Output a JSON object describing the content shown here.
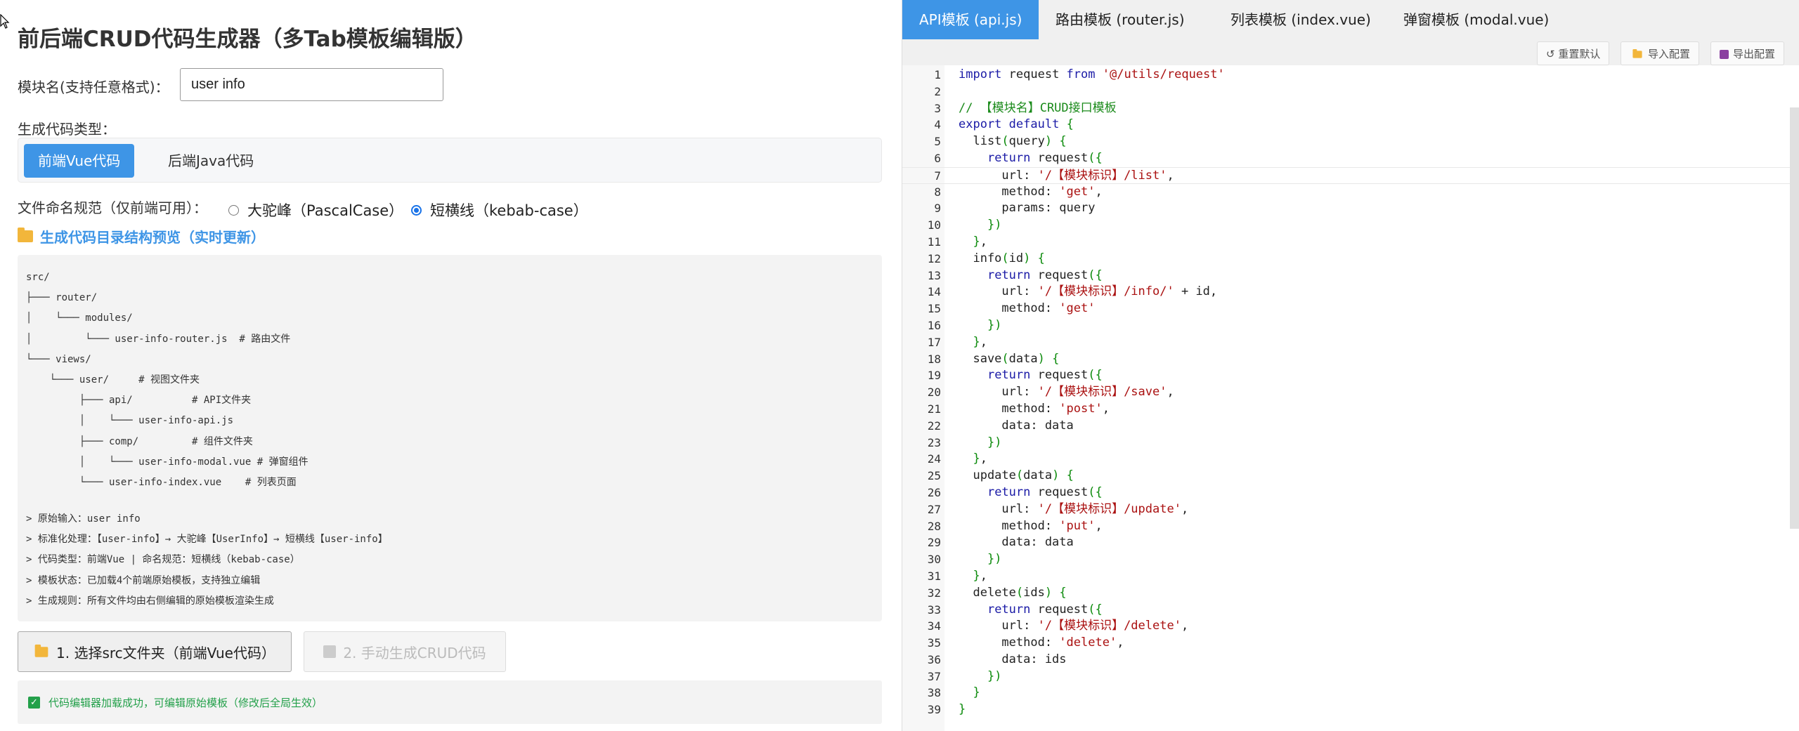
{
  "left": {
    "title": "前后端CRUD代码生成器（多Tab模板编辑版）",
    "module_label": "模块名(支持任意格式)：",
    "module_value": "user info",
    "type_label": "生成代码类型：",
    "type_buttons": [
      "前端Vue代码",
      "后端Java代码"
    ],
    "naming_label": "文件命名规范（仅前端可用）：",
    "naming_options": [
      "大驼峰（PascalCase）",
      "短横线（kebab-case）"
    ],
    "naming_selected": "短横线（kebab-case）",
    "preview_title": "生成代码目录结构预览（实时更新）",
    "tree": [
      "src/",
      "├─── router/",
      "│    └─── modules/",
      "│         └─── user-info-router.js  # 路由文件",
      "└─── views/",
      "    └─── user/     # 视图文件夹",
      "         ├─── api/          # API文件夹",
      "         │    └─── user-info-api.js",
      "         ├─── comp/         # 组件文件夹",
      "         │    └─── user-info-modal.vue # 弹窗组件",
      "         └─── user-info-index.vue    # 列表页面"
    ],
    "info": [
      "> 原始输入：user info",
      "> 标准化处理：【user-info】→ 大驼峰【UserInfo】→ 短横线【user-info】",
      "> 代码类型：前端Vue | 命名规范：短横线（kebab-case）",
      "> 模板状态：已加载4个前端原始模板，支持独立编辑",
      "> 生成规则：所有文件均由右侧编辑的原始模板渲染生成"
    ],
    "btn_select": "1. 选择src文件夹（前端Vue代码）",
    "btn_generate": "2. 手动生成CRUD代码",
    "status": "代码编辑器加载成功，可编辑原始模板（修改后全局生效）"
  },
  "right": {
    "tabs": [
      "API模板 (api.js)",
      "路由模板 (router.js)",
      "列表模板 (index.vue)",
      "弹窗模板 (modal.vue)"
    ],
    "tools": [
      "↺ 重置默认",
      "导入配置",
      "导出配置"
    ],
    "code": [
      "import request from '@/utils/request'",
      "",
      "// 【模块名】CRUD接口模板",
      "export default {",
      "  list(query) {",
      "    return request({",
      "      url: '/【模块标识】/list',",
      "      method: 'get',",
      "      params: query",
      "    })",
      "  },",
      "  info(id) {",
      "    return request({",
      "      url: '/【模块标识】/info/' + id,",
      "      method: 'get'",
      "    })",
      "  },",
      "  save(data) {",
      "    return request({",
      "      url: '/【模块标识】/save',",
      "      method: 'post',",
      "      data: data",
      "    })",
      "  },",
      "  update(data) {",
      "    return request({",
      "      url: '/【模块标识】/update',",
      "      method: 'put',",
      "      data: data",
      "    })",
      "  },",
      "  delete(ids) {",
      "    return request({",
      "      url: '/【模块标识】/delete',",
      "      method: 'delete',",
      "      data: ids",
      "    })",
      "  }",
      "}"
    ]
  }
}
